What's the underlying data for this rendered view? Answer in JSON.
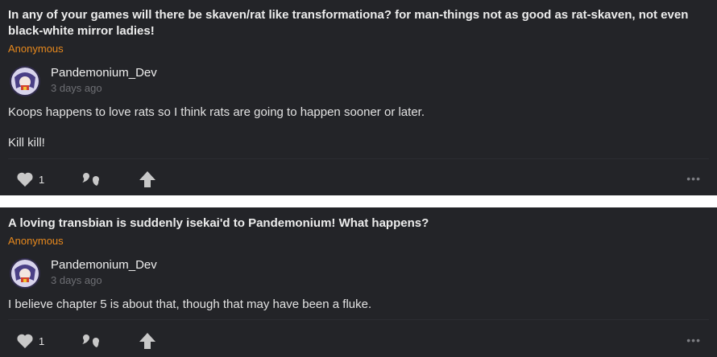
{
  "posts": [
    {
      "question": "In any of your games will there be skaven/rat like transformationa? for man-things not as good as rat-skaven, not even black-white mirror ladies!",
      "asker": "Anonymous",
      "author": "Pandemonium_Dev",
      "time": "3 days ago",
      "answer_lines": [
        "Koops happens to love rats so I think rats are going to happen sooner or later.",
        "Kill kill!"
      ],
      "likes": "1",
      "icons": {
        "like": "heart-icon",
        "reply": "quote-icon",
        "share": "share-arrow-icon",
        "more": "more-options-icon"
      }
    },
    {
      "question": "A loving transbian is suddenly isekai'd to Pandemonium! What happens?",
      "asker": "Anonymous",
      "author": "Pandemonium_Dev",
      "time": "3 days ago",
      "answer_lines": [
        "I believe chapter 5 is about that, though that may have been a fluke."
      ],
      "likes": "1",
      "icons": {
        "like": "heart-icon",
        "reply": "quote-icon",
        "share": "share-arrow-icon",
        "more": "more-options-icon"
      }
    }
  ],
  "colors": {
    "card_bg": "#232428",
    "asker": "#e8891d",
    "separator": "#ffffff"
  },
  "more_glyph": "•••"
}
